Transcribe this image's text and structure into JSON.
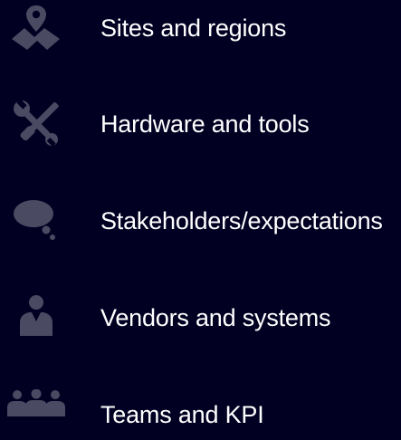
{
  "menu": {
    "items": [
      {
        "label": "Sites and regions",
        "icon": "map-pin-icon"
      },
      {
        "label": "Hardware and tools",
        "icon": "tools-icon"
      },
      {
        "label": "Stakeholders/expectations",
        "icon": "thought-bubble-icon"
      },
      {
        "label": "Vendors and systems",
        "icon": "person-icon"
      },
      {
        "label": "Teams and KPI",
        "icon": "team-icon"
      }
    ]
  },
  "colors": {
    "background": "#020022",
    "icon": "#4a4a62",
    "text": "#ffffff"
  }
}
